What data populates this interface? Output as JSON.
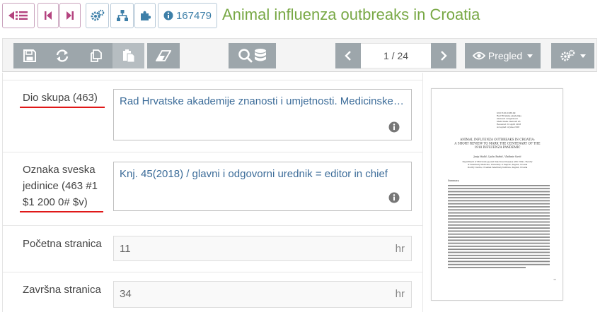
{
  "header": {
    "record_id": "167479",
    "title": "Animal influenza outbreaks in Croatia",
    "icons": [
      "back-list-icon",
      "first-record-icon",
      "last-record-icon",
      "settings-icon",
      "hierarchy-icon",
      "puzzle-icon",
      "info-icon"
    ]
  },
  "toolbar": {
    "icons": [
      "save-icon",
      "refresh-icon",
      "copy-icon",
      "paste-icon",
      "eraser-icon",
      "search-database-icon"
    ],
    "pager_text": "1 / 24",
    "view_label": "Pregled",
    "colors": {
      "button": "#9da6ab",
      "title": "#78a845",
      "link": "#3c6c99",
      "underline": "#e01818"
    }
  },
  "form": {
    "fields": [
      {
        "label_lines": [
          "Dio skupa (463)"
        ],
        "value": "Rad Hrvatske akademije znanosti i umjetnosti. Medicinske znanosti",
        "has_info": true
      },
      {
        "label_lines": [
          "Oznaka sveska",
          "jedinice (463 #1",
          "$1 200 0# $v)"
        ],
        "value": "Knj. 45(2018) / glavni i odgovorni urednik = editor in chief",
        "has_info": true
      },
      {
        "label_lines": [
          "Početna stranica"
        ],
        "value": "11",
        "unit": "hr"
      },
      {
        "label_lines": [
          "Završna stranica"
        ],
        "value": "34",
        "unit": "hr"
      }
    ]
  },
  "preview": {
    "header_lines": [
      "UDC 616.9:636.09",
      "Rad Hrvatske akademije",
      "znanosti i umjetnosti",
      "Medicinske znanosti 45",
      "Received: 10 April 2018",
      "Accepted: 4 June 2018"
    ],
    "title_lines": [
      "ANIMAL INFLUENZA OUTBREAKS IN CROATIA:",
      "A SHORT REVIEW TO MARK THE CENTENARY OF THE",
      "1918 INFLUENZA PANDEMIC"
    ],
    "authors": "Josip Madić, Ljubo Barbić, Vladimir Savić",
    "affiliation_lines": [
      "Department of Microbiology and Infectious Diseases with Clinic, Faculty",
      "of Veterinary Medicine, University of Zagreb, Zagreb, Croatia",
      "Poultry Centre, Croatian Veterinary Institute, Zagreb, Croatia"
    ],
    "section": "Summary",
    "page_number": "11"
  }
}
